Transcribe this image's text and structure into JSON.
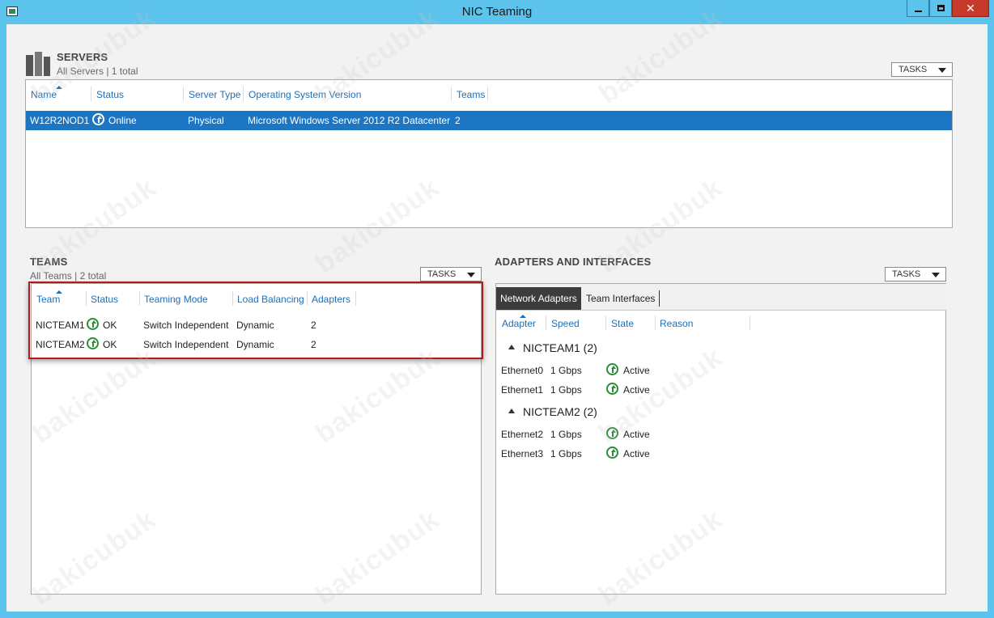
{
  "window": {
    "title": "NIC Teaming"
  },
  "servers": {
    "title": "SERVERS",
    "subtitle": "All Servers | 1 total",
    "tasks_label": "TASKS",
    "columns": [
      "Name",
      "Status",
      "Server Type",
      "Operating System Version",
      "Teams"
    ],
    "rows": [
      {
        "name": "W12R2NOD1",
        "status": "Online",
        "server_type": "Physical",
        "os": "Microsoft Windows Server 2012 R2 Datacenter",
        "teams": "2"
      }
    ]
  },
  "teams": {
    "title": "TEAMS",
    "subtitle": "All Teams | 2 total",
    "tasks_label": "TASKS",
    "columns": [
      "Team",
      "Status",
      "Teaming Mode",
      "Load Balancing",
      "Adapters"
    ],
    "rows": [
      {
        "team": "NICTEAM1",
        "status": "OK",
        "mode": "Switch Independent",
        "balancing": "Dynamic",
        "adapters": "2"
      },
      {
        "team": "NICTEAM2",
        "status": "OK",
        "mode": "Switch Independent",
        "balancing": "Dynamic",
        "adapters": "2"
      }
    ]
  },
  "adapters": {
    "title": "ADAPTERS AND INTERFACES",
    "tasks_label": "TASKS",
    "tabs": [
      "Network Adapters",
      "Team Interfaces"
    ],
    "columns": [
      "Adapter",
      "Speed",
      "State",
      "Reason"
    ],
    "groups": [
      {
        "label": "NICTEAM1 (2)",
        "rows": [
          {
            "adapter": "Ethernet0",
            "speed": "1 Gbps",
            "state": "Active"
          },
          {
            "adapter": "Ethernet1",
            "speed": "1 Gbps",
            "state": "Active"
          }
        ]
      },
      {
        "label": "NICTEAM2 (2)",
        "rows": [
          {
            "adapter": "Ethernet2",
            "speed": "1 Gbps",
            "state": "Active"
          },
          {
            "adapter": "Ethernet3",
            "speed": "1 Gbps",
            "state": "Active"
          }
        ]
      }
    ]
  },
  "watermark": "bakicubuk",
  "colors": {
    "titlebar": "#5bc3ec",
    "selection": "#1c76c4",
    "header_link": "#1e6fb8",
    "highlight_box": "#b31b1b",
    "ok_green": "#2e8b3a"
  }
}
